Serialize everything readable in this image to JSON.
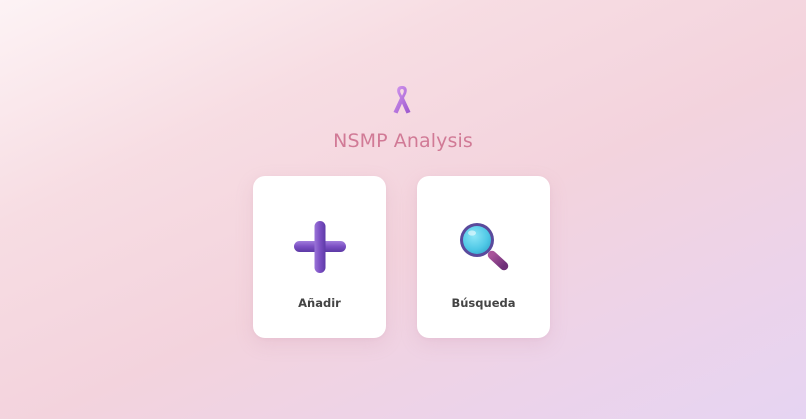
{
  "header": {
    "logo_icon": "awareness-ribbon-icon",
    "title": "NSMP Analysis"
  },
  "actions": [
    {
      "label": "Añadir",
      "icon": "plus-icon"
    },
    {
      "label": "Búsqueda",
      "icon": "magnifier-icon"
    }
  ],
  "colors": {
    "title": "#d17a96",
    "ribbon": "#b774db",
    "plus": "#7a4fc0",
    "lens": "#5ad0ea",
    "lens_frame": "#5a4a9c"
  }
}
